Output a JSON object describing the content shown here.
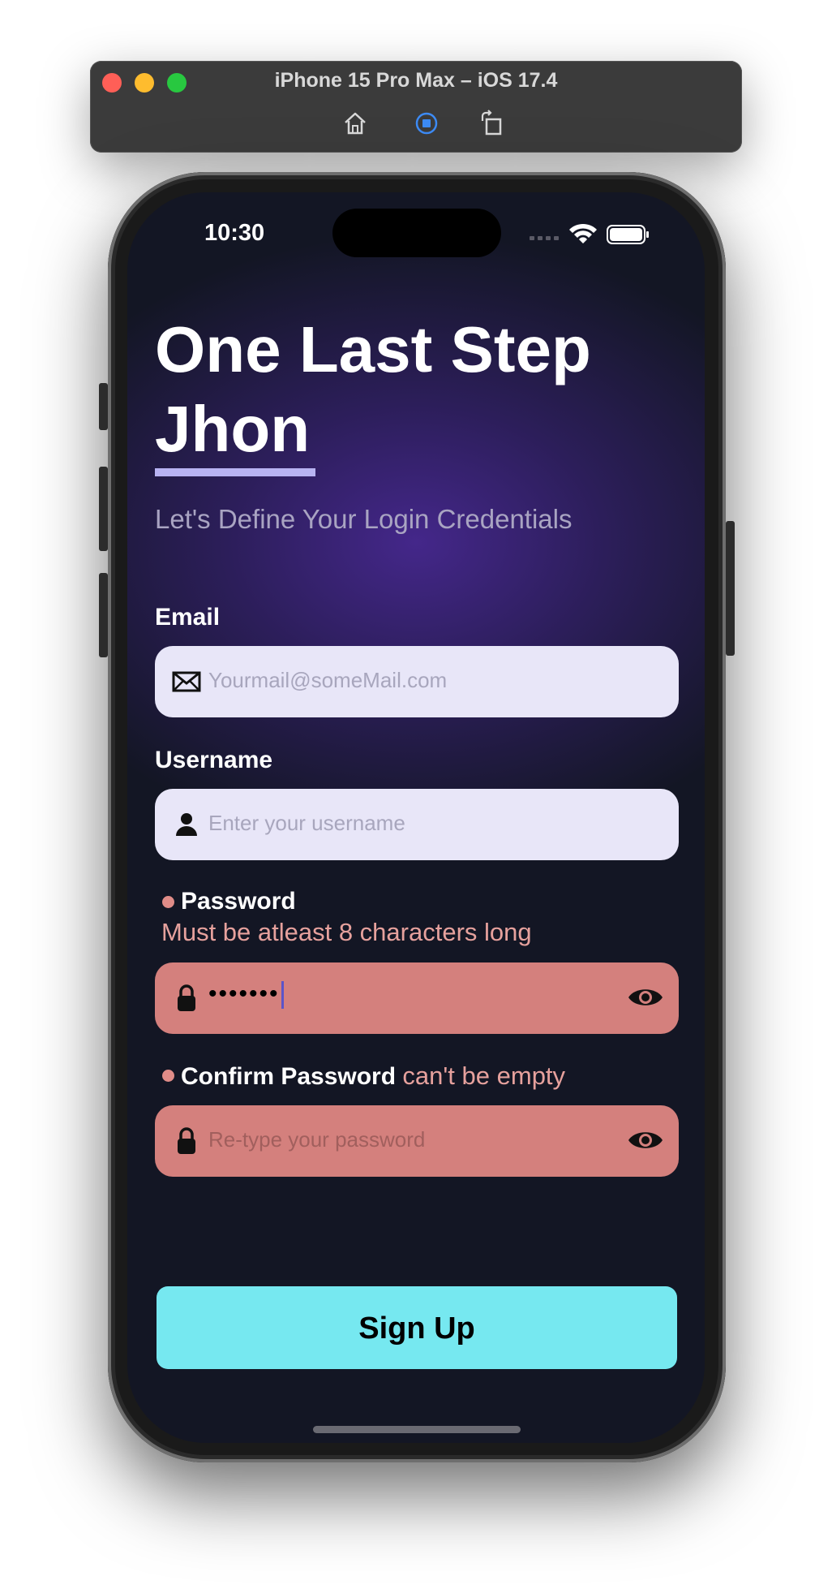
{
  "simulator": {
    "title": "iPhone 15 Pro Max – iOS 17.4",
    "controls": [
      "home-icon",
      "record-icon",
      "rotate-icon"
    ]
  },
  "status_bar": {
    "time": "10:30"
  },
  "header": {
    "title_line1": "One Last Step",
    "title_line2": "Jhon",
    "subtitle": "Let's Define Your Login Credentials"
  },
  "form": {
    "email": {
      "label": "Email",
      "placeholder": "Yourmail@someMail.com",
      "icon": "envelope-icon"
    },
    "username": {
      "label": "Username",
      "placeholder": "Enter your username",
      "icon": "person-icon"
    },
    "password": {
      "label": "Password",
      "error": "Must be atleast 8 characters long",
      "value": "•••••••",
      "icon": "lock-icon"
    },
    "confirm_password": {
      "label": "Confirm Password",
      "error": "can't be empty",
      "placeholder": "Re-type your password",
      "icon": "lock-icon"
    }
  },
  "actions": {
    "signup_label": "Sign Up"
  },
  "colors": {
    "accent_button": "#76e8f0",
    "error_field": "#d4807d",
    "normal_field": "#e8e6f8",
    "underline": "#b8b3f2",
    "background": "#131624"
  }
}
